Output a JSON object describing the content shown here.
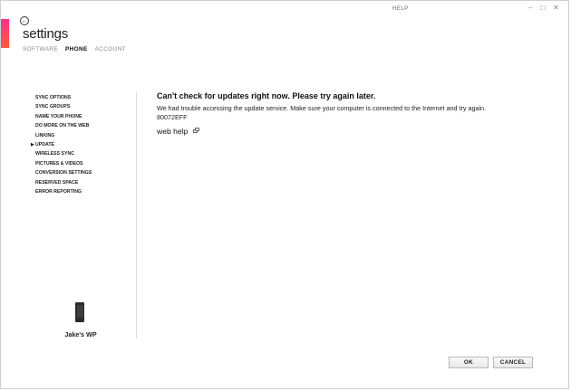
{
  "window": {
    "help_label": "HELP",
    "controls": [
      "–",
      "□",
      "✕"
    ]
  },
  "header": {
    "title": "settings",
    "tabs": [
      {
        "label": "SOFTWARE",
        "active": false
      },
      {
        "label": "PHONE",
        "active": true
      },
      {
        "label": "ACCOUNT",
        "active": false
      }
    ]
  },
  "sidebar": {
    "items": [
      {
        "label": "SYNC OPTIONS"
      },
      {
        "label": "SYNC GROUPS"
      },
      {
        "label": "NAME YOUR PHONE"
      },
      {
        "label": "DO MORE ON THE WEB"
      },
      {
        "label": "LINKING"
      },
      {
        "label": "UPDATE",
        "selected": true
      },
      {
        "label": "WIRELESS SYNC"
      },
      {
        "label": "PICTURES & VIDEOS"
      },
      {
        "label": "CONVERSION SETTINGS"
      },
      {
        "label": "RESERVED SPACE"
      },
      {
        "label": "ERROR REPORTING"
      }
    ],
    "device_name": "Jake's WP"
  },
  "main": {
    "headline": "Can't check for updates right now. Please try again later.",
    "body": "We had trouble accessing the update service. Make sure your computer is connected to the Internet and try again.",
    "error_code": "80072EFF",
    "web_help_label": "web help"
  },
  "footer": {
    "ok_label": "OK",
    "cancel_label": "CANCEL"
  },
  "colors": {
    "accent_top": "#ff2c8b",
    "accent_bottom": "#ff5a3a"
  }
}
